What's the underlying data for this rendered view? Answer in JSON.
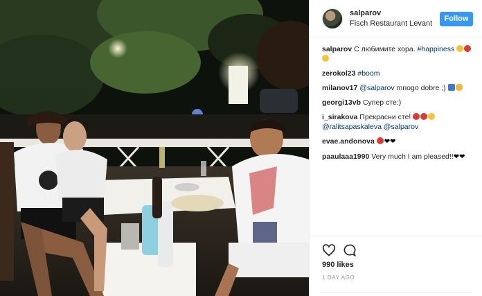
{
  "header": {
    "username": "salparov",
    "location": "Fisch Restaurant Levant",
    "follow_label": "Follow"
  },
  "comments": [
    {
      "user": "salparov",
      "parts": [
        "С любимите хора. ",
        "#happiness"
      ],
      "emoji": [
        "yellow",
        "red",
        "yellow"
      ]
    },
    {
      "user": "zerokol23",
      "parts": [
        "",
        "#boom"
      ]
    },
    {
      "user": "milanov17",
      "parts": [
        "@salparov",
        " mnogo dobre ;)"
      ],
      "emoji": [
        "blue",
        "hand"
      ]
    },
    {
      "user": "georgi13vb",
      "parts": [
        "Супер сте:)"
      ]
    },
    {
      "user": "i_sirakova",
      "parts": [
        "Прекрасни сте!"
      ],
      "emoji": [
        "red",
        "red",
        "yellow"
      ],
      "extra": "@ralitsapaskaleva @salparov"
    },
    {
      "user": "evae.andonova",
      "parts": [
        ""
      ],
      "emoji": [
        "red"
      ],
      "hearts": "❤❤"
    },
    {
      "user": "paaulaaa1990",
      "parts": [
        "Very much I am pleased!!"
      ],
      "hearts": "❤❤"
    }
  ],
  "actions": {
    "like_icon": "heart-outline-icon",
    "comment_icon": "comment-bubble-icon",
    "likes": "990 likes",
    "time_ago": "1 DAY AGO"
  },
  "photo": {
    "description_icon": "restaurant-photo"
  }
}
